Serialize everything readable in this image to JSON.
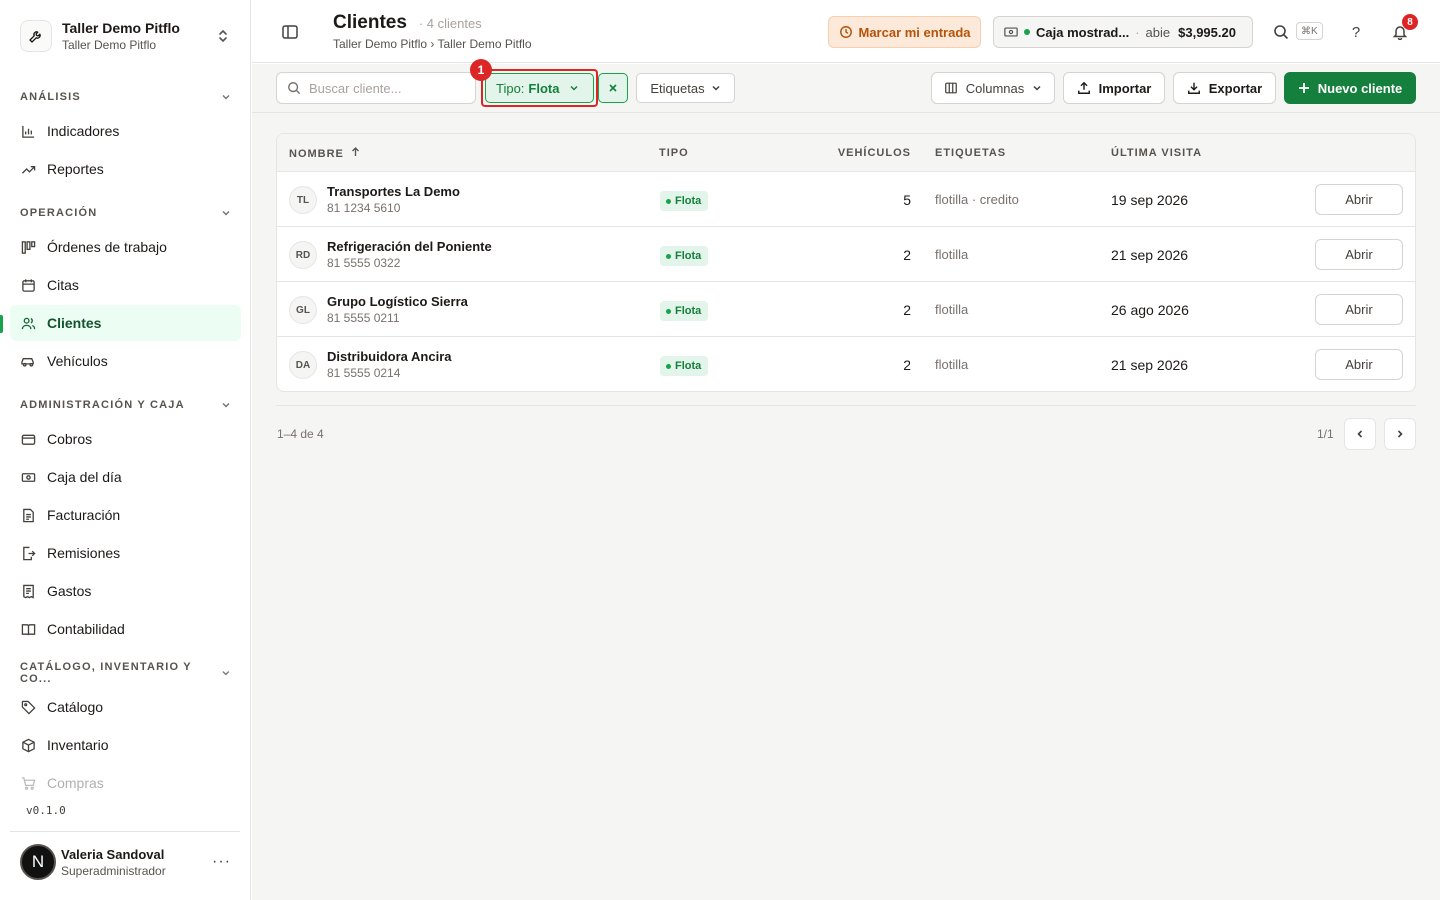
{
  "org": {
    "name": "Taller Demo Pitflo",
    "sub": "Taller Demo Pitflo"
  },
  "sidebar": {
    "sections": [
      {
        "label": "ANÁLISIS"
      },
      {
        "label": "OPERACIÓN"
      },
      {
        "label": "ADMINISTRACIÓN Y CAJA"
      },
      {
        "label": "CATÁLOGO, INVENTARIO Y CO..."
      }
    ],
    "items": [
      {
        "label": "Indicadores",
        "icon": "chart-bars-icon"
      },
      {
        "label": "Reportes",
        "icon": "trend-icon"
      },
      {
        "label": "Órdenes de trabajo",
        "icon": "kanban-icon"
      },
      {
        "label": "Citas",
        "icon": "calendar-icon"
      },
      {
        "label": "Clientes",
        "icon": "users-icon"
      },
      {
        "label": "Vehículos",
        "icon": "car-icon"
      },
      {
        "label": "Cobros",
        "icon": "wallet-icon"
      },
      {
        "label": "Caja del día",
        "icon": "cash-icon"
      },
      {
        "label": "Facturación",
        "icon": "document-icon"
      },
      {
        "label": "Remisiones",
        "icon": "file-export-icon"
      },
      {
        "label": "Gastos",
        "icon": "receipt-icon"
      },
      {
        "label": "Contabilidad",
        "icon": "book-icon"
      },
      {
        "label": "Catálogo",
        "icon": "tag-icon"
      },
      {
        "label": "Inventario",
        "icon": "box-icon"
      },
      {
        "label": "Compras",
        "icon": "cart-icon"
      }
    ],
    "version": "v0.1.0"
  },
  "user": {
    "initial": "N",
    "name": "Valeria Sandoval",
    "role": "Superadministrador"
  },
  "header": {
    "title": "Clientes",
    "count": "4 clientes",
    "breadcrumb": "Taller Demo Pitflo › Taller Demo Pitflo",
    "clock_in": "Marcar mi entrada",
    "cash": {
      "name": "Caja mostrad...",
      "status": "abie",
      "amount": "$3,995.20"
    },
    "shortcut": "⌘K",
    "notifications": "8"
  },
  "toolbar": {
    "search_placeholder": "Buscar cliente...",
    "filter_label": "Tipo:",
    "filter_value": "Flota",
    "marker": "1",
    "tags_label": "Etiquetas",
    "columns_label": "Columnas",
    "import_label": "Importar",
    "export_label": "Exportar",
    "new_label": "Nuevo cliente"
  },
  "table": {
    "headers": {
      "name": "NOMBRE",
      "type": "TIPO",
      "vehicles": "VEHÍCULOS",
      "tags": "ETIQUETAS",
      "last_visit": "ÚLTIMA VISITA"
    },
    "open_label": "Abrir",
    "rows": [
      {
        "initials": "TL",
        "name": "Transportes La Demo",
        "phone": "81 1234 5610",
        "type": "Flota",
        "vehicles": "5",
        "tags": "flotilla · credito",
        "last_visit": "19 sep 2026"
      },
      {
        "initials": "RD",
        "name": "Refrigeración del Poniente",
        "phone": "81 5555 0322",
        "type": "Flota",
        "vehicles": "2",
        "tags": "flotilla",
        "last_visit": "21 sep 2026"
      },
      {
        "initials": "GL",
        "name": "Grupo Logístico Sierra",
        "phone": "81 5555 0211",
        "type": "Flota",
        "vehicles": "2",
        "tags": "flotilla",
        "last_visit": "26 ago 2026"
      },
      {
        "initials": "DA",
        "name": "Distribuidora Ancira",
        "phone": "81 5555 0214",
        "type": "Flota",
        "vehicles": "2",
        "tags": "flotilla",
        "last_visit": "21 sep 2026"
      }
    ]
  },
  "pagination": {
    "range": "1–4 de 4",
    "page": "1/1"
  },
  "colors": {
    "brand": "#15803d",
    "accent_bg": "#e3f4ea",
    "danger": "#dc2626",
    "warning": "#b45309"
  }
}
